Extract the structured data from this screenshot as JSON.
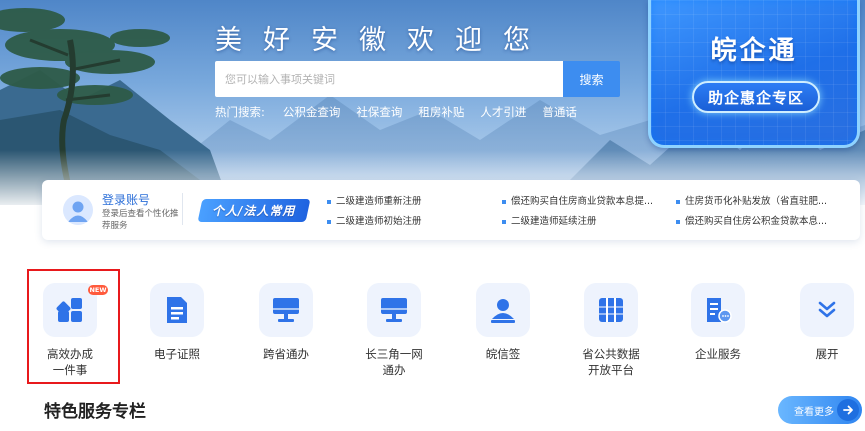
{
  "hero": {
    "slogan": "美好安徽欢迎您",
    "search_placeholder": "您可以输入事项关键词",
    "search_button": "搜索",
    "hot_label": "热门搜索:",
    "hot_keywords": [
      "公积金查询",
      "社保查询",
      "租房补贴",
      "人才引进",
      "普通话"
    ]
  },
  "promo": {
    "title": "皖企通",
    "button": "助企惠企专区"
  },
  "login": {
    "title": "登录账号",
    "desc": "登录后查看个性化推荐服务",
    "tag": "个人/法人常用"
  },
  "news": [
    "二级建造师重新注册",
    "二级建造师初始注册",
    "偿还购买自住房商业贷款本息提...",
    "二级建造师延续注册",
    "住房货币化补贴发放（省直驻肥...",
    "偿还购买自住房公积金贷款本息..."
  ],
  "services": [
    {
      "line1": "高效办成",
      "line2": "一件事",
      "icon": "apps-icon"
    },
    {
      "line1": "电子证照",
      "line2": "",
      "icon": "document-icon"
    },
    {
      "line1": "跨省通办",
      "line2": "",
      "icon": "monitor-icon"
    },
    {
      "line1": "长三角一网",
      "line2": "通办",
      "icon": "monitor-icon"
    },
    {
      "line1": "皖信签",
      "line2": "",
      "icon": "user-sign-icon"
    },
    {
      "line1": "省公共数据",
      "line2": "开放平台",
      "icon": "database-icon"
    },
    {
      "line1": "企业服务",
      "line2": "",
      "icon": "enterprise-icon"
    },
    {
      "line1": "展开",
      "line2": "",
      "icon": "chevron-down-icon"
    }
  ],
  "new_badge": "NEW",
  "section": {
    "title": "特色服务专栏",
    "more": "查看更多"
  },
  "colors": {
    "accent": "#3d8df0",
    "highlight": "#e8191c",
    "icon_bg": "#eef3fd"
  }
}
